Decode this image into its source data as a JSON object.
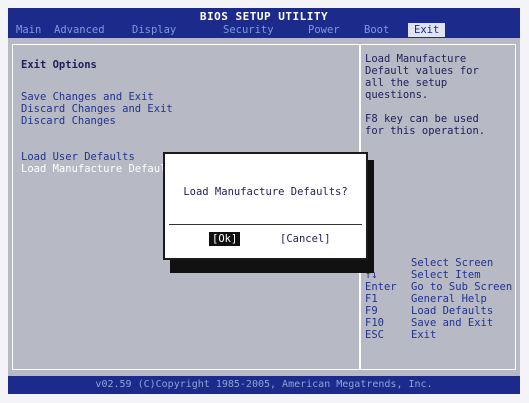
{
  "window": {
    "title": "BIOS SETUP UTILITY"
  },
  "menu": [
    {
      "label": "Main"
    },
    {
      "label": "Advanced"
    },
    {
      "label": "Display"
    },
    {
      "label": "Security"
    },
    {
      "label": "Power"
    },
    {
      "label": "Boot"
    },
    {
      "label": "Exit",
      "active": true
    }
  ],
  "left_panel": {
    "heading": "Exit Options",
    "options": [
      {
        "label": "Save Changes and Exit"
      },
      {
        "label": "Discard Changes and Exit"
      },
      {
        "label": "Discard Changes"
      },
      {
        "label": "Load User Defaults"
      },
      {
        "label": "Load Manufacture Defaults",
        "selected": true
      }
    ]
  },
  "right_panel": {
    "help_lines": [
      "Load Manufacture",
      "Default values for",
      "all the setup",
      "questions.",
      "",
      "F8 key can be used",
      "for this operation."
    ],
    "keys": [
      {
        "key": "←",
        "desc": "Select Screen"
      },
      {
        "key": "↑↓",
        "desc": "Select Item"
      },
      {
        "key": "Enter",
        "desc": "Go to Sub Screen"
      },
      {
        "key": "F1",
        "desc": "General Help"
      },
      {
        "key": "F9",
        "desc": "Load Defaults"
      },
      {
        "key": "F10",
        "desc": "Save and Exit"
      },
      {
        "key": "ESC",
        "desc": "Exit"
      }
    ]
  },
  "dialog": {
    "question": "Load Manufacture Defaults?",
    "ok_label": "[Ok]",
    "cancel_label": "[Cancel]"
  },
  "footer": {
    "copyright": "v02.59 (C)Copyright 1985-2005, American Megatrends, Inc."
  },
  "colors": {
    "bar_blue": "#1c2a8c",
    "panel_gray": "#b7b9c4",
    "text_dark": "#1e1e5a",
    "text_highlight": "#ffffff"
  }
}
